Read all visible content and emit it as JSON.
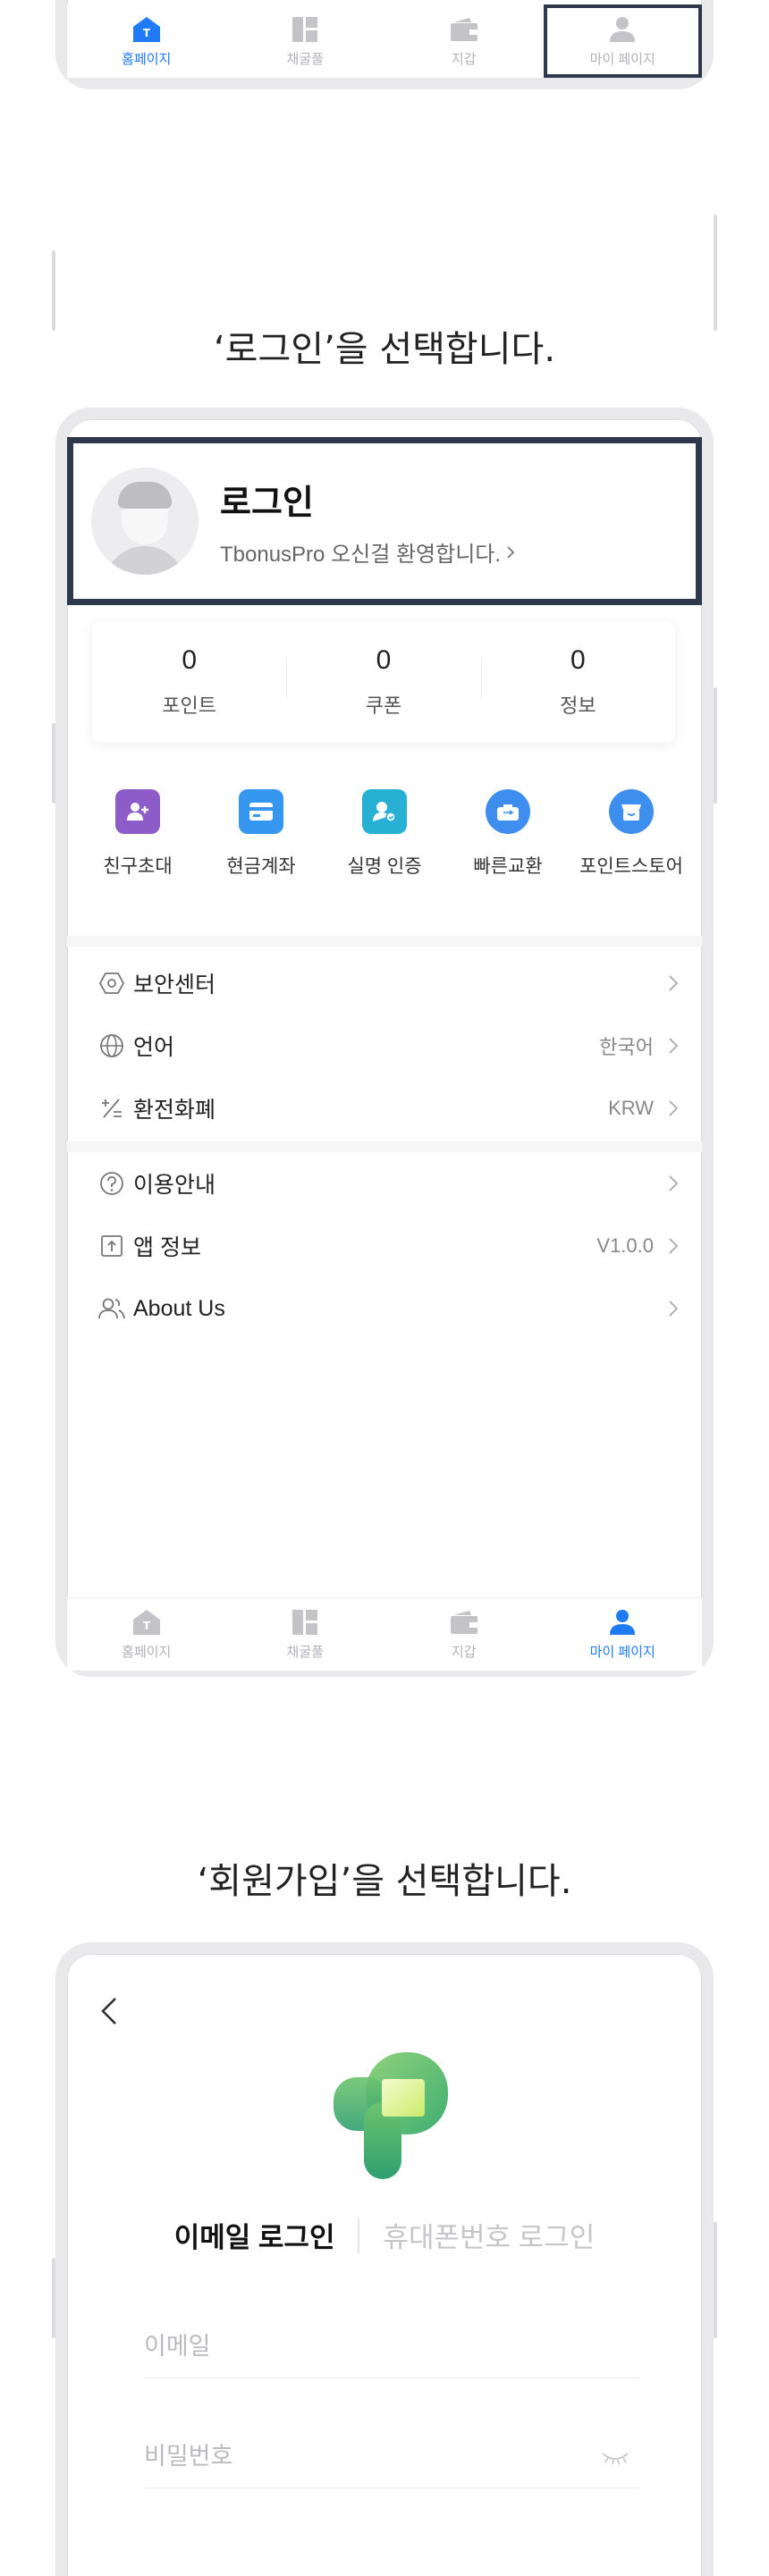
{
  "colors": {
    "accent": "#1e7bf5",
    "highlight_frame": "#2e3a4b",
    "inactive": "#b2b2b8"
  },
  "tabbar": {
    "items": [
      {
        "label": "홈페이지",
        "icon": "home-icon"
      },
      {
        "label": "채굴풀",
        "icon": "grid-icon"
      },
      {
        "label": "지갑",
        "icon": "wallet-icon"
      },
      {
        "label": "마이 페이지",
        "icon": "user-icon"
      }
    ]
  },
  "step2": {
    "caption": "‘로그인’을 선택합니다.",
    "profile": {
      "title": "로그인",
      "subtitle": "TbonusPro 오신걸 환영합니다.",
      "avatar": "default-avatar"
    },
    "stats": [
      {
        "value": "0",
        "label": "포인트"
      },
      {
        "value": "0",
        "label": "쿠폰"
      },
      {
        "value": "0",
        "label": "정보"
      }
    ],
    "shortcuts": [
      {
        "label": "친구초대",
        "icon": "invite-friend-icon",
        "color": "#8d5cc9"
      },
      {
        "label": "현금계좌",
        "icon": "card-icon",
        "color": "#3597ef"
      },
      {
        "label": "실명 인증",
        "icon": "id-verify-icon",
        "color": "#27b0d3"
      },
      {
        "label": "빠른교환",
        "icon": "quick-exchange-icon",
        "color": "#3e8ef0"
      },
      {
        "label": "포인트스토어",
        "icon": "store-icon",
        "color": "#3e8ef0"
      }
    ],
    "menu_group1": [
      {
        "label": "보안센터",
        "value": "",
        "icon": "shield-hex-icon"
      },
      {
        "label": "언어",
        "value": "한국어",
        "icon": "globe-icon"
      },
      {
        "label": "환전화폐",
        "value": "KRW",
        "icon": "currency-icon"
      }
    ],
    "menu_group2": [
      {
        "label": "이용안내",
        "value": "",
        "icon": "help-icon"
      },
      {
        "label": "앱 정보",
        "value": "V1.0.0",
        "icon": "app-info-icon"
      },
      {
        "label": "About Us",
        "value": "",
        "icon": "people-icon"
      }
    ]
  },
  "step3": {
    "caption": "‘회원가입’을 선택합니다.",
    "tabs": {
      "email": "이메일 로그인",
      "phone": "휴대폰번호 로그인"
    },
    "email_placeholder": "이메일",
    "password_placeholder": "비밀번호"
  }
}
